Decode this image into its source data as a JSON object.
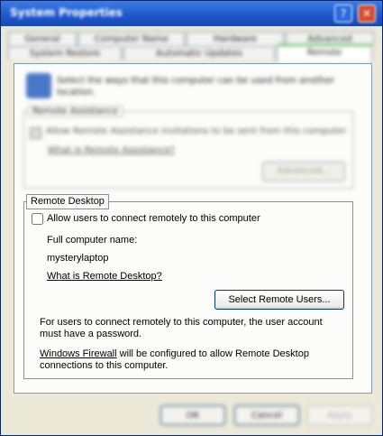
{
  "window": {
    "title": "System Properties"
  },
  "tabs": {
    "row_back": [
      "General",
      "Computer Name",
      "Hardware",
      "Advanced"
    ],
    "row_front": [
      "System Restore",
      "Automatic Updates",
      "Remote"
    ]
  },
  "remote": {
    "intro": "Select the ways that this computer can be used from another location.",
    "assistance": {
      "legend": "Remote Assistance",
      "allow_label": "Allow Remote Assistance invitations to be sent from this computer",
      "what_link": "What is Remote Assistance?",
      "advanced_button": "Advanced..."
    },
    "desktop": {
      "legend": "Remote Desktop",
      "allow_label": "Allow users to connect remotely to this computer",
      "allow_checked": false,
      "full_name_label": "Full computer name:",
      "computer_name": "mysterylaptop",
      "what_link": "What is Remote Desktop?",
      "select_users_button": "Select Remote Users...",
      "account_note": "For users to connect remotely to this computer, the user account must have a password.",
      "firewall_link": "Windows Firewall",
      "firewall_note": " will be configured to allow Remote Desktop connections to this computer."
    }
  },
  "buttons": {
    "ok": "OK",
    "cancel": "Cancel",
    "apply": "Apply"
  }
}
